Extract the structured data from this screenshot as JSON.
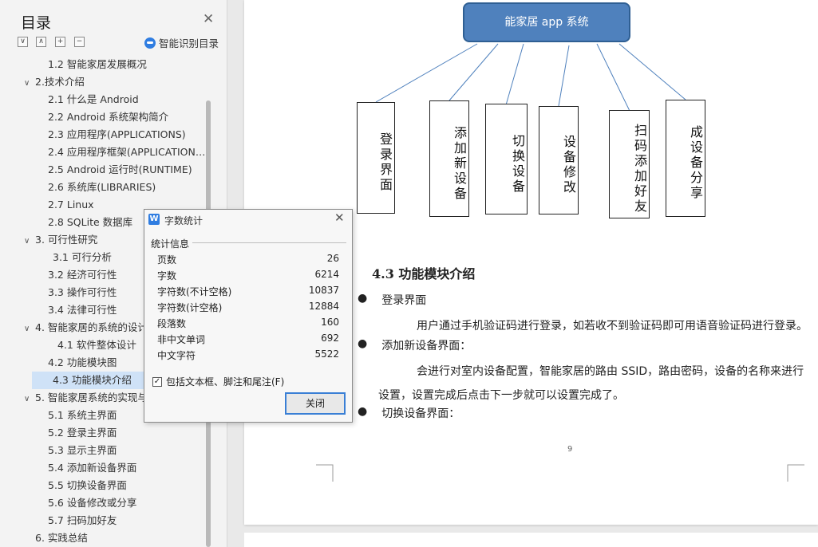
{
  "toc": {
    "title": "目录",
    "ai_label": "智能识别目录",
    "buttons": [
      "∨",
      "∧",
      "+",
      "−"
    ],
    "items": [
      {
        "label": "1.2 智能家居发展概况",
        "level": 2
      },
      {
        "label": "2.技术介绍",
        "level": 1,
        "expanded": true
      },
      {
        "label": "2.1 什么是 Android",
        "level": 2
      },
      {
        "label": "2.2 Android 系统架构简介",
        "level": 2
      },
      {
        "label": "2.3 应用程序(APPLICATIONS)",
        "level": 2
      },
      {
        "label": "2.4 应用程序框架(APPLICATION…",
        "level": 2
      },
      {
        "label": "2.5 Android  运行时(RUNTIME)",
        "level": 2
      },
      {
        "label": "2.6 系统库(LIBRARIES)",
        "level": 2
      },
      {
        "label": "2.7 Linux",
        "level": 2
      },
      {
        "label": "2.8 SQLite 数据库",
        "level": 2
      },
      {
        "label": "3. 可行性研究",
        "level": 1,
        "expanded": true
      },
      {
        "label": "3.1 可行分析",
        "level": 3
      },
      {
        "label": "3.2 经济可行性",
        "level": 2
      },
      {
        "label": "3.3 操作可行性",
        "level": 2
      },
      {
        "label": "3.4 法律可行性",
        "level": 2
      },
      {
        "label": "4. 智能家居的系统的设计",
        "level": 1,
        "expanded": true
      },
      {
        "label": "4.1  软件整体设计",
        "level": 4
      },
      {
        "label": "4.2 功能模块图",
        "level": 2
      },
      {
        "label": "4.3  功能模块介绍",
        "level": 3,
        "selected": true
      },
      {
        "label": "5. 智能家居系统的实现与",
        "level": 1,
        "expanded": true
      },
      {
        "label": "5.1 系统主界面",
        "level": 2
      },
      {
        "label": "5.2 登录主界面",
        "level": 2
      },
      {
        "label": "5.3 显示主界面",
        "level": 2
      },
      {
        "label": "5.4 添加新设备界面",
        "level": 2
      },
      {
        "label": "5.5 切换设备界面",
        "level": 2
      },
      {
        "label": "5.6 设备修改或分享",
        "level": 2
      },
      {
        "label": "5.7 扫码加好友",
        "level": 2
      },
      {
        "label": "6. 实践总结",
        "level": 1
      }
    ]
  },
  "diagram": {
    "root": "能家居 app 系统",
    "nodes": [
      "登录界面",
      "添加新设备",
      "切换设备",
      "设备修改",
      "扫码添加好友",
      "成设备分享"
    ]
  },
  "document": {
    "heading": "4.3  功能模块介绍",
    "bullet1": "登录界面",
    "para1": "用户通过手机验证码进行登录，如若收不到验证码即可用语音验证码进行登录。",
    "bullet2": "添加新设备界面：",
    "para2a": "会进行对室内设备配置，智能家居的路由 SSID，路由密码，设备的名称来进行",
    "para2b": "设置，设置完成后点击下一步就可以设置完成了。",
    "bullet3": "切换设备界面：",
    "page_number": "9"
  },
  "dialog": {
    "title": "字数统计",
    "group_label": "统计信息",
    "stats": [
      {
        "label": "页数",
        "value": "26"
      },
      {
        "label": "字数",
        "value": "6214"
      },
      {
        "label": "字符数(不计空格)",
        "value": "10837"
      },
      {
        "label": "字符数(计空格)",
        "value": "12884"
      },
      {
        "label": "段落数",
        "value": "160"
      },
      {
        "label": "非中文单词",
        "value": "692"
      },
      {
        "label": "中文字符",
        "value": "5522"
      }
    ],
    "checkbox_label": "包括文本框、脚注和尾注(F)",
    "checkbox_checked": true,
    "close_label": "关闭"
  },
  "colors": {
    "accent": "#2f7de1",
    "root_box": "#4f81bd",
    "selection": "#cfe2f7"
  }
}
